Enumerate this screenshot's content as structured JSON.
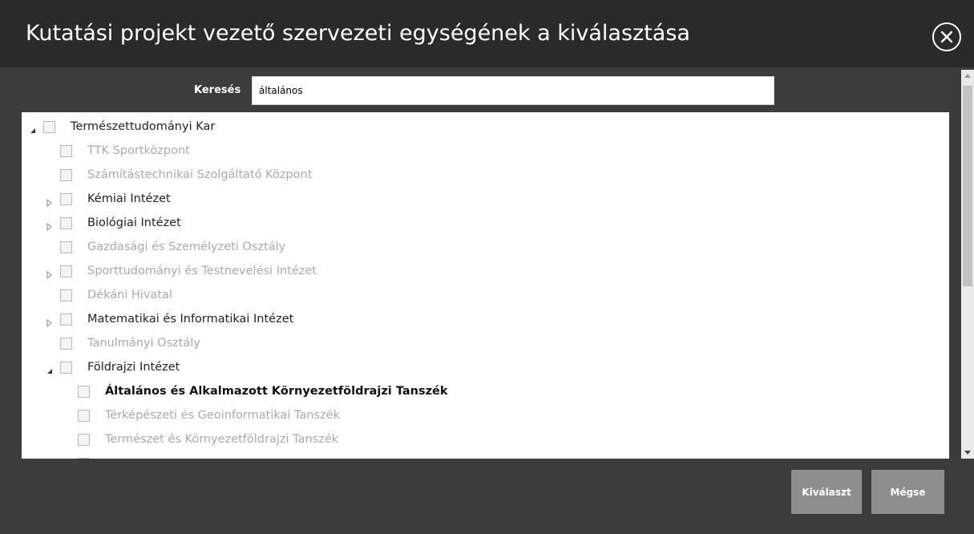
{
  "dialog": {
    "title": "Kutatási projekt vezető szervezeti egységének a kiválasztása",
    "close_icon": "close-circle-icon"
  },
  "search": {
    "label": "Keresés",
    "value": "általános"
  },
  "tree": {
    "items": [
      {
        "label": "Természettudományi Kar",
        "toggle": "expanded",
        "state": "normal"
      },
      {
        "label": "TTK Sportközpont",
        "toggle": "none",
        "state": "muted"
      },
      {
        "label": "Számítástechnikai Szolgáltató Központ",
        "toggle": "none",
        "state": "muted"
      },
      {
        "label": "Kémiai Intézet",
        "toggle": "collapsed",
        "state": "normal"
      },
      {
        "label": "Biológiai Intézet",
        "toggle": "collapsed",
        "state": "normal"
      },
      {
        "label": "Gazdasági és Személyzeti Osztály",
        "toggle": "none",
        "state": "muted"
      },
      {
        "label": "Sporttudományi és Testnevelési Intézet",
        "toggle": "collapsed",
        "state": "muted"
      },
      {
        "label": "Dékáni Hivatal",
        "toggle": "none",
        "state": "muted"
      },
      {
        "label": "Matematikai és Informatikai Intézet",
        "toggle": "collapsed",
        "state": "normal"
      },
      {
        "label": "Tanulmányi Osztály",
        "toggle": "none",
        "state": "muted"
      },
      {
        "label": "Földrajzi Intézet",
        "toggle": "expanded",
        "state": "normal"
      },
      {
        "label": "Általános és Alkalmazott Környezetföldrajzi Tanszék",
        "toggle": "none",
        "state": "match"
      },
      {
        "label": "Térképészeti és Geoinformatikai Tanszék",
        "toggle": "none",
        "state": "muted"
      },
      {
        "label": "Természet és Környezetföldrajzi Tanszék",
        "toggle": "none",
        "state": "muted"
      }
    ]
  },
  "buttons": {
    "select_label": "Kiválaszt",
    "cancel_label": "Mégse"
  },
  "colors": {
    "title_bar": "#2a2a2a",
    "body": "#3c3c3c",
    "button": "#8e8e8e",
    "muted_text": "#a9a9a9"
  }
}
